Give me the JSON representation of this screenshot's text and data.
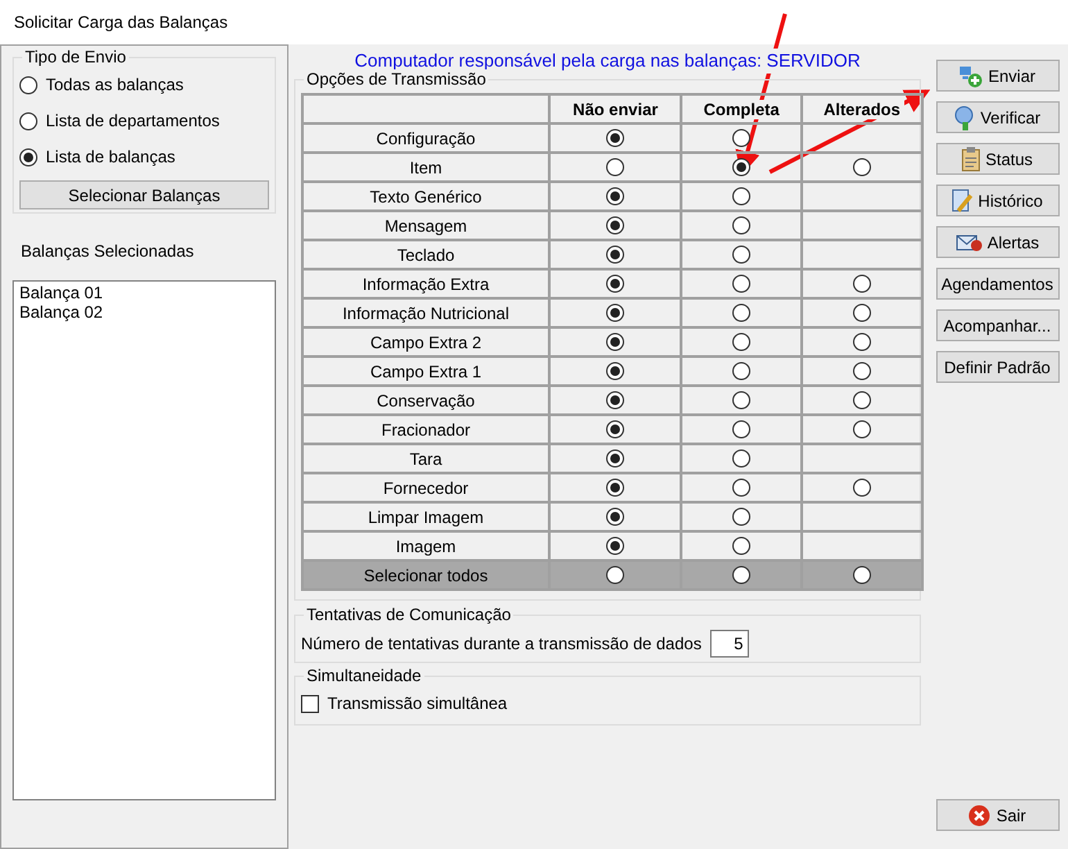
{
  "window": {
    "title": "Solicitar Carga das Balanças"
  },
  "send_type": {
    "title": "Tipo de Envio",
    "options": [
      {
        "label": "Todas as balanças",
        "selected": false
      },
      {
        "label": "Lista de departamentos",
        "selected": false
      },
      {
        "label": "Lista de balanças",
        "selected": true
      }
    ],
    "select_button": "Selecionar Balanças"
  },
  "selected_scales": {
    "label": "Balanças Selecionadas",
    "items": [
      "Balança 01",
      "Balança 02"
    ]
  },
  "server_heading": "Computador responsável pela carga nas balanças: SERVIDOR",
  "transmission": {
    "title": "Opções de Transmissão",
    "columns": [
      "Não enviar",
      "Completa",
      "Alterados"
    ],
    "rows": [
      {
        "kind": "item",
        "label": "Configuração",
        "cells": [
          {
            "kind": "radio",
            "selected": true
          },
          {
            "kind": "radio",
            "selected": false
          },
          {
            "kind": "empty"
          }
        ]
      },
      {
        "kind": "item",
        "label": "Item",
        "cells": [
          {
            "kind": "radio",
            "selected": false
          },
          {
            "kind": "radio",
            "selected": true
          },
          {
            "kind": "radio",
            "selected": false
          }
        ]
      },
      {
        "kind": "item",
        "label": "Texto Genérico",
        "cells": [
          {
            "kind": "radio",
            "selected": true
          },
          {
            "kind": "radio",
            "selected": false
          },
          {
            "kind": "empty"
          }
        ]
      },
      {
        "kind": "item",
        "label": "Mensagem",
        "cells": [
          {
            "kind": "radio",
            "selected": true
          },
          {
            "kind": "radio",
            "selected": false
          },
          {
            "kind": "empty"
          }
        ]
      },
      {
        "kind": "item",
        "label": "Teclado",
        "cells": [
          {
            "kind": "radio",
            "selected": true
          },
          {
            "kind": "radio",
            "selected": false
          },
          {
            "kind": "empty"
          }
        ]
      },
      {
        "kind": "item",
        "label": "Informação Extra",
        "cells": [
          {
            "kind": "radio",
            "selected": true
          },
          {
            "kind": "radio",
            "selected": false
          },
          {
            "kind": "radio",
            "selected": false
          }
        ]
      },
      {
        "kind": "item",
        "label": "Informação Nutricional",
        "cells": [
          {
            "kind": "radio",
            "selected": true
          },
          {
            "kind": "radio",
            "selected": false
          },
          {
            "kind": "radio",
            "selected": false
          }
        ]
      },
      {
        "kind": "item",
        "label": "Campo Extra 2",
        "cells": [
          {
            "kind": "radio",
            "selected": true
          },
          {
            "kind": "radio",
            "selected": false
          },
          {
            "kind": "radio",
            "selected": false
          }
        ]
      },
      {
        "kind": "item",
        "label": "Campo Extra 1",
        "cells": [
          {
            "kind": "radio",
            "selected": true
          },
          {
            "kind": "radio",
            "selected": false
          },
          {
            "kind": "radio",
            "selected": false
          }
        ]
      },
      {
        "kind": "item",
        "label": "Conservação",
        "cells": [
          {
            "kind": "radio",
            "selected": true
          },
          {
            "kind": "radio",
            "selected": false
          },
          {
            "kind": "radio",
            "selected": false
          }
        ]
      },
      {
        "kind": "item",
        "label": "Fracionador",
        "cells": [
          {
            "kind": "radio",
            "selected": true
          },
          {
            "kind": "radio",
            "selected": false
          },
          {
            "kind": "radio",
            "selected": false
          }
        ]
      },
      {
        "kind": "item",
        "label": "Tara",
        "cells": [
          {
            "kind": "radio",
            "selected": true
          },
          {
            "kind": "radio",
            "selected": false
          },
          {
            "kind": "empty"
          }
        ]
      },
      {
        "kind": "item",
        "label": "Fornecedor",
        "cells": [
          {
            "kind": "radio",
            "selected": true
          },
          {
            "kind": "radio",
            "selected": false
          },
          {
            "kind": "radio",
            "selected": false
          }
        ]
      },
      {
        "kind": "item",
        "label": "Limpar Imagem",
        "cells": [
          {
            "kind": "radio",
            "selected": true
          },
          {
            "kind": "radio",
            "selected": false
          },
          {
            "kind": "empty"
          }
        ]
      },
      {
        "kind": "item",
        "label": "Imagem",
        "cells": [
          {
            "kind": "radio",
            "selected": true
          },
          {
            "kind": "radio",
            "selected": false
          },
          {
            "kind": "empty"
          }
        ]
      },
      {
        "kind": "select_all",
        "label": "Selecionar todos",
        "cells": [
          {
            "kind": "radio",
            "selected": false
          },
          {
            "kind": "radio",
            "selected": false
          },
          {
            "kind": "radio",
            "selected": false
          }
        ]
      }
    ]
  },
  "attempts": {
    "title": "Tentativas de Comunicação",
    "label": "Número de tentativas durante a transmissão de dados",
    "value": "5"
  },
  "simultaneity": {
    "title": "Simultaneidade",
    "label": "Transmissão simultânea",
    "checked": false
  },
  "actions": [
    {
      "label": "Enviar"
    },
    {
      "label": "Verificar"
    },
    {
      "label": "Status"
    },
    {
      "label": "Histórico"
    },
    {
      "label": "Alertas"
    },
    {
      "label": "Agendamentos"
    },
    {
      "label": "Acompanhar..."
    },
    {
      "label": "Definir Padrão"
    }
  ],
  "exit_button": "Sair"
}
